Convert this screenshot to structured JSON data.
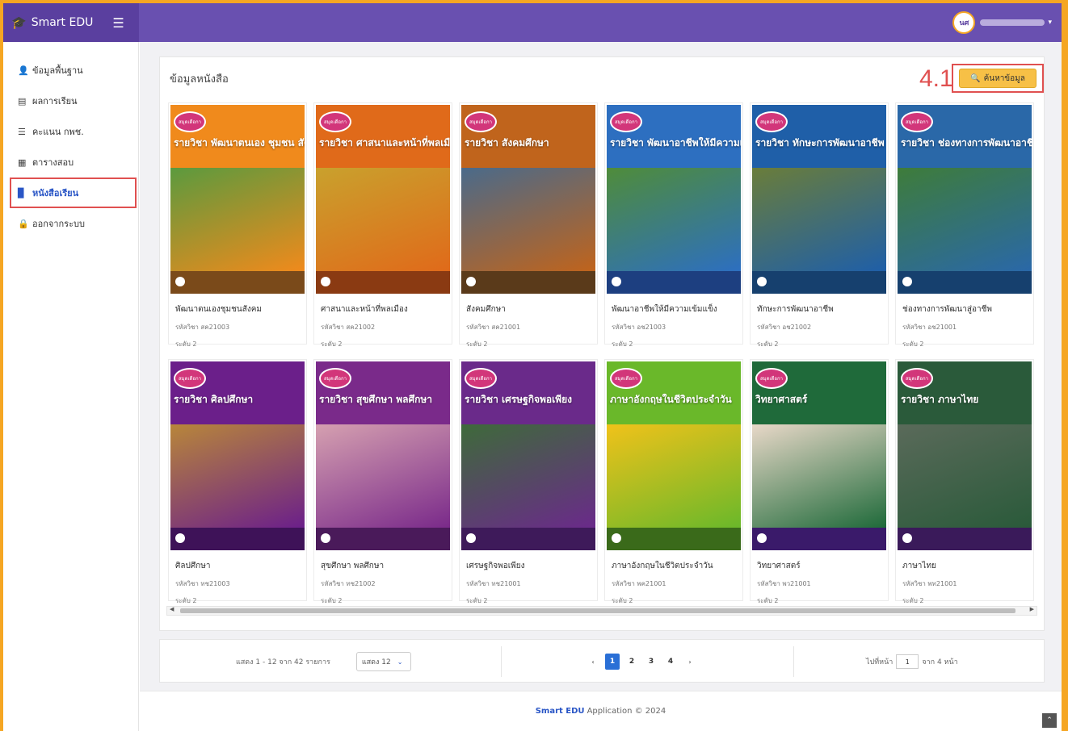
{
  "app": {
    "name": "Smart EDU",
    "brand_icon": "graduation-cap-icon",
    "menu_icon": "hamburger-icon"
  },
  "user": {
    "avatar_text": "นศ",
    "name": ""
  },
  "sidebar": {
    "items": [
      {
        "label": "ข้อมูลพื้นฐาน",
        "icon": "user-icon",
        "glyph": "👤"
      },
      {
        "label": "ผลการเรียน",
        "icon": "id-card-icon",
        "glyph": "▤"
      },
      {
        "label": "คะแนน กพช.",
        "icon": "list-icon",
        "glyph": "☰"
      },
      {
        "label": "ตารางสอบ",
        "icon": "calendar-icon",
        "glyph": "▦"
      },
      {
        "label": "หนังสือเรียน",
        "icon": "book-icon",
        "glyph": "▉"
      },
      {
        "label": "ออกจากระบบ",
        "icon": "lock-icon",
        "glyph": "🔒"
      }
    ],
    "active_index": 4
  },
  "content": {
    "title": "ข้อมูลหนังสือ",
    "callout": "4.1",
    "search_label": "ค้นหาข้อมูล"
  },
  "books": [
    {
      "name": "พัฒนาตนเองชุมชนสังคม",
      "code": "รหัสวิชา สค21003",
      "level": "ระดับ 2",
      "cover_title": "รายวิชา พัฒนาตนเอง ชุมชน สังคม",
      "badge": "สมุดเดือกา",
      "colors": {
        "cover": "#f08a1c",
        "photo": "#5b9a3e",
        "footer": "#7a4a1a"
      }
    },
    {
      "name": "ศาสนาและหน้าที่พลเมือง",
      "code": "รหัสวิชา สค21002",
      "level": "ระดับ 2",
      "cover_title": "รายวิชา ศาสนาและหน้าที่พลเมือง",
      "badge": "สมุดเดือกา",
      "colors": {
        "cover": "#e06a1a",
        "photo": "#c9a12d",
        "footer": "#8a3a12"
      }
    },
    {
      "name": "สังคมศึกษา",
      "code": "รหัสวิชา สค21001",
      "level": "ระดับ 2",
      "cover_title": "รายวิชา สังคมศึกษา",
      "badge": "สมุดเดือกา",
      "colors": {
        "cover": "#c0641c",
        "photo": "#4a6a8a",
        "footer": "#5a3a1a"
      }
    },
    {
      "name": "พัฒนาอาชีพให้มีความเข้มแข็ง",
      "code": "รหัสวิชา อช21003",
      "level": "ระดับ 2",
      "cover_title": "รายวิชา พัฒนาอาชีพให้มีความเข้มแข็ง",
      "badge": "สมุดเดือกา",
      "colors": {
        "cover": "#2d6fc0",
        "photo": "#4f8c3a",
        "footer": "#1d3f80"
      }
    },
    {
      "name": "ทักษะการพัฒนาอาชีพ",
      "code": "รหัสวิชา อช21002",
      "level": "ระดับ 2",
      "cover_title": "รายวิชา ทักษะการพัฒนาอาชีพ",
      "badge": "สมุดเดือกา",
      "colors": {
        "cover": "#1f5fa8",
        "photo": "#6a7d3a",
        "footer": "#16406e"
      }
    },
    {
      "name": "ช่องทางการพัฒนาสู่อาชีพ",
      "code": "รหัสวิชา อช21001",
      "level": "ระดับ 2",
      "cover_title": "รายวิชา ช่องทางการพัฒนาอาชีพ",
      "badge": "สมุดเดือกา",
      "colors": {
        "cover": "#2a68a8",
        "photo": "#3e7c3a",
        "footer": "#16406e"
      }
    },
    {
      "name": "ศิลปศึกษา",
      "code": "รหัสวิชา ทช21003",
      "level": "ระดับ 2",
      "cover_title": "รายวิชา ศิลปศึกษา",
      "badge": "สมุดเดือกา",
      "colors": {
        "cover": "#6b1f8a",
        "photo": "#b8863a",
        "footer": "#3e1258"
      }
    },
    {
      "name": "สุขศึกษา พลศึกษา",
      "code": "รหัสวิชา ทช21002",
      "level": "ระดับ 2",
      "cover_title": "รายวิชา สุขศึกษา พลศึกษา",
      "badge": "สมุดเดือกา",
      "colors": {
        "cover": "#7a2a8a",
        "photo": "#d5a0b0",
        "footer": "#4a1a5a"
      }
    },
    {
      "name": "เศรษฐกิจพอเพียง",
      "code": "รหัสวิชา ทช21001",
      "level": "ระดับ 2",
      "cover_title": "รายวิชา เศรษฐกิจพอเพียง",
      "badge": "สมุดเดือกา",
      "colors": {
        "cover": "#6a2a8a",
        "photo": "#3e6a3a",
        "footer": "#3e1a5a"
      }
    },
    {
      "name": "ภาษาอังกฤษในชีวิตประจำวัน",
      "code": "รหัสวิชา พค21001",
      "level": "ระดับ 2",
      "cover_title": "ภาษาอังกฤษในชีวิตประจำวัน",
      "badge": "สมุดเดือกา",
      "colors": {
        "cover": "#6ab82a",
        "photo": "#f0c21a",
        "footer": "#3a6a1a"
      }
    },
    {
      "name": "วิทยาศาสตร์",
      "code": "รหัสวิชา พว21001",
      "level": "ระดับ 2",
      "cover_title": "วิทยาศาสตร์",
      "badge": "สมุดเดือกา",
      "colors": {
        "cover": "#1f6a3a",
        "photo": "#e8d8c8",
        "footer": "#3a1a6a"
      }
    },
    {
      "name": "ภาษาไทย",
      "code": "รหัสวิชา พท21001",
      "level": "ระดับ 2",
      "cover_title": "รายวิชา ภาษาไทย",
      "badge": "สมุดเดือกา",
      "colors": {
        "cover": "#2a5a3a",
        "photo": "#5a6a5a",
        "footer": "#3a1a5a"
      }
    }
  ],
  "pagination": {
    "summary": "แสดง 1 - 12 จาก 42 รายการ",
    "page_size_label": "แสดง 12",
    "pages": [
      "1",
      "2",
      "3",
      "4"
    ],
    "current_page": "1",
    "prev": "‹",
    "next": "›",
    "goto_label": "ไปที่หน้า",
    "goto_value": "1",
    "total_label": "จาก 4 หน้า"
  },
  "footer": {
    "brand": "Smart EDU",
    "rest": "Application © 2024",
    "scroll_top": "⌃"
  },
  "colors": {
    "topbar": "#6950b0",
    "brand_bg": "#5a3f9f",
    "highlight": "#e05050",
    "search_btn": "#f7c046",
    "frame": "#f5a623",
    "accent": "#2a6fd6"
  }
}
